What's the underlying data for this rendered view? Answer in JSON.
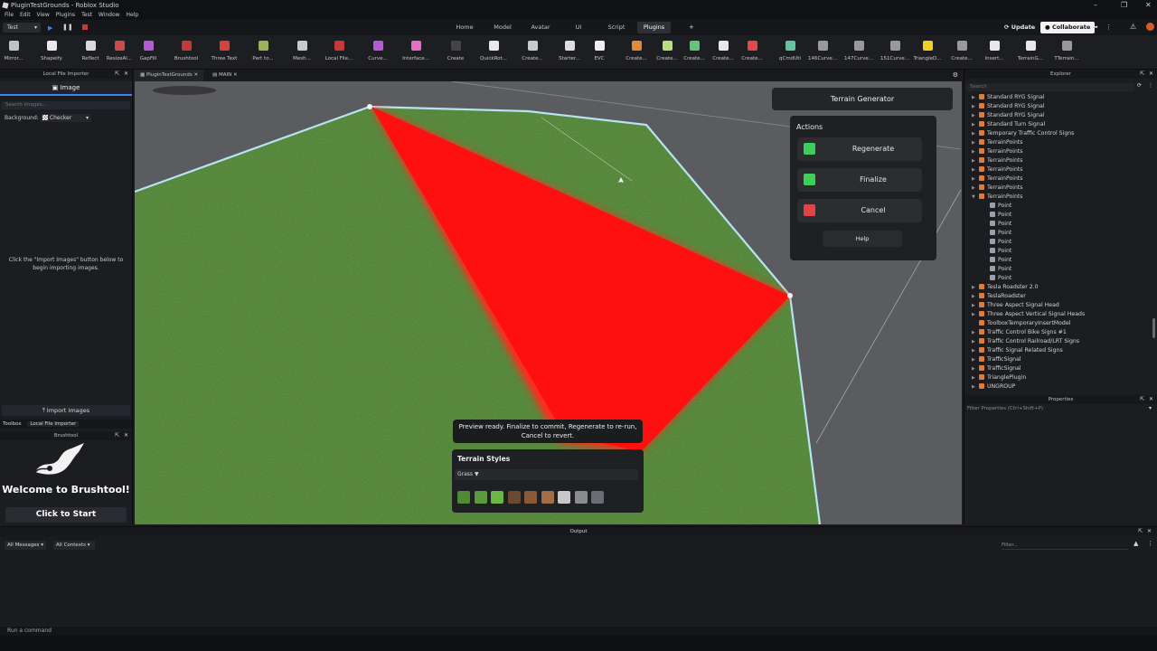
{
  "window": {
    "title": "PluginTestGrounds - Roblox Studio"
  },
  "menu": [
    "File",
    "Edit",
    "View",
    "Plugins",
    "Test",
    "Window",
    "Help"
  ],
  "mode_select": "Test",
  "ribbon_tabs": [
    "Home",
    "Model",
    "Avatar",
    "UI",
    "Script",
    "Plugins"
  ],
  "active_tab": "Plugins",
  "top_buttons": {
    "update": "Update",
    "collaborate": "Collaborate"
  },
  "tools": [
    "Mirror...",
    "Shapeify",
    "Reflect",
    "ResizeAl...",
    "GapFill",
    "Brushtool",
    "Three Text",
    "Part to...",
    "Mesh...",
    "Local File...",
    "Curve...",
    "Interface...",
    "Create",
    "QuickRot...",
    "Create...",
    "Starter...",
    "EVC",
    "Create...",
    "Create...",
    "Create...",
    "Create...",
    "Create...",
    "qCmdUtl",
    "146Curve...",
    "147Curve...",
    "151Curve...",
    "TriangleD...",
    "Create...",
    "Insert...",
    "TerrainG...",
    "TTerrain..."
  ],
  "left_panel": {
    "header": "Local File Importer",
    "tab": "Image",
    "search_placeholder": "Search images...",
    "background_label": "Background:",
    "background_value": "Checker",
    "hint": "Click the \"Import Images\" button below to begin importing images.",
    "import_button": "Import Images",
    "bottom_tabs": [
      "Toolbox",
      "Local File Importer"
    ]
  },
  "brushtool": {
    "header": "Brushtool",
    "welcome": "Welcome to Brushtool!",
    "start": "Click to Start"
  },
  "doc_tabs": [
    "PluginTestGrounds",
    "MAIN"
  ],
  "terrain_generator": {
    "title": "Terrain Generator",
    "actions_label": "Actions",
    "actions": [
      {
        "label": "Regenerate",
        "color": "#3ecf5a"
      },
      {
        "label": "Finalize",
        "color": "#3ecf5a"
      },
      {
        "label": "Cancel",
        "color": "#e2434b"
      }
    ],
    "help": "Help"
  },
  "preview_message": "Preview ready. Finalize to commit, Regenerate to re-run, Cancel to revert.",
  "terrain_styles": {
    "title": "Terrain Styles",
    "selected": "Grass ▼",
    "swatches": [
      "#4f8a34",
      "#5a9a3a",
      "#6cb644",
      "#6b4a2e",
      "#8a5a36",
      "#a26e48",
      "#c8c8c8",
      "#8a8b8e",
      "#6a6d72"
    ]
  },
  "explorer": {
    "header": "Explorer",
    "search_placeholder": "Search",
    "items": [
      {
        "label": "Standard RYG Signal",
        "indent": 1,
        "arrow": "▶",
        "color": "#e07b3a"
      },
      {
        "label": "Standard RYG Signal",
        "indent": 1,
        "arrow": "▶",
        "color": "#e07b3a"
      },
      {
        "label": "Standard RYG Signal",
        "indent": 1,
        "arrow": "▶",
        "color": "#e07b3a"
      },
      {
        "label": "Standard Turn Signal",
        "indent": 1,
        "arrow": "▶",
        "color": "#e07b3a"
      },
      {
        "label": "Temporary Traffic Control Signs",
        "indent": 1,
        "arrow": "▶",
        "color": "#e07b3a"
      },
      {
        "label": "TerrainPoints",
        "indent": 1,
        "arrow": "▶",
        "color": "#e07b3a"
      },
      {
        "label": "TerrainPoints",
        "indent": 1,
        "arrow": "▶",
        "color": "#e07b3a"
      },
      {
        "label": "TerrainPoints",
        "indent": 1,
        "arrow": "▶",
        "color": "#e07b3a"
      },
      {
        "label": "TerrainPoints",
        "indent": 1,
        "arrow": "▶",
        "color": "#e07b3a"
      },
      {
        "label": "TerrainPoints",
        "indent": 1,
        "arrow": "▶",
        "color": "#e07b3a"
      },
      {
        "label": "TerrainPoints",
        "indent": 1,
        "arrow": "▶",
        "color": "#e07b3a"
      },
      {
        "label": "TerrainPoints",
        "indent": 1,
        "arrow": "▼",
        "color": "#e07b3a"
      },
      {
        "label": "Point",
        "indent": 2,
        "arrow": "",
        "color": "#9aa0a8"
      },
      {
        "label": "Point",
        "indent": 2,
        "arrow": "",
        "color": "#9aa0a8"
      },
      {
        "label": "Point",
        "indent": 2,
        "arrow": "",
        "color": "#9aa0a8"
      },
      {
        "label": "Point",
        "indent": 2,
        "arrow": "",
        "color": "#9aa0a8"
      },
      {
        "label": "Point",
        "indent": 2,
        "arrow": "",
        "color": "#9aa0a8"
      },
      {
        "label": "Point",
        "indent": 2,
        "arrow": "",
        "color": "#9aa0a8"
      },
      {
        "label": "Point",
        "indent": 2,
        "arrow": "",
        "color": "#9aa0a8"
      },
      {
        "label": "Point",
        "indent": 2,
        "arrow": "",
        "color": "#9aa0a8"
      },
      {
        "label": "Point",
        "indent": 2,
        "arrow": "",
        "color": "#9aa0a8"
      },
      {
        "label": "Tesla Roadster 2.0",
        "indent": 1,
        "arrow": "▶",
        "color": "#e07b3a"
      },
      {
        "label": "TeslaRoadster",
        "indent": 1,
        "arrow": "▶",
        "color": "#e07b3a"
      },
      {
        "label": "Three Aspect Signal Head",
        "indent": 1,
        "arrow": "▶",
        "color": "#e07b3a"
      },
      {
        "label": "Three Aspect Vertical Signal Heads",
        "indent": 1,
        "arrow": "▶",
        "color": "#e07b3a"
      },
      {
        "label": "ToolboxTemporaryInsertModel",
        "indent": 1,
        "arrow": "",
        "color": "#e07b3a"
      },
      {
        "label": "Traffic Control Bike Signs #1",
        "indent": 1,
        "arrow": "▶",
        "color": "#e07b3a"
      },
      {
        "label": "Traffic Control Railroad/LRT Signs",
        "indent": 1,
        "arrow": "▶",
        "color": "#e07b3a"
      },
      {
        "label": "Traffic Signal Related Signs",
        "indent": 1,
        "arrow": "▶",
        "color": "#e07b3a"
      },
      {
        "label": "TrafficSignal",
        "indent": 1,
        "arrow": "▶",
        "color": "#e07b3a"
      },
      {
        "label": "TrafficSignal",
        "indent": 1,
        "arrow": "▶",
        "color": "#e07b3a"
      },
      {
        "label": "TrianglePlugin",
        "indent": 1,
        "arrow": "▶",
        "color": "#e07b3a"
      },
      {
        "label": "UNGROUP",
        "indent": 1,
        "arrow": "▶",
        "color": "#e07b3a"
      }
    ]
  },
  "properties": {
    "header": "Properties",
    "filter_placeholder": "Filter Properties (Ctrl+Shift+P)"
  },
  "output": {
    "header": "Output",
    "messages_filter": "All Messages",
    "contexts_filter": "All Contexts",
    "filter_placeholder": "Filter...",
    "command_placeholder": "Run a command"
  }
}
